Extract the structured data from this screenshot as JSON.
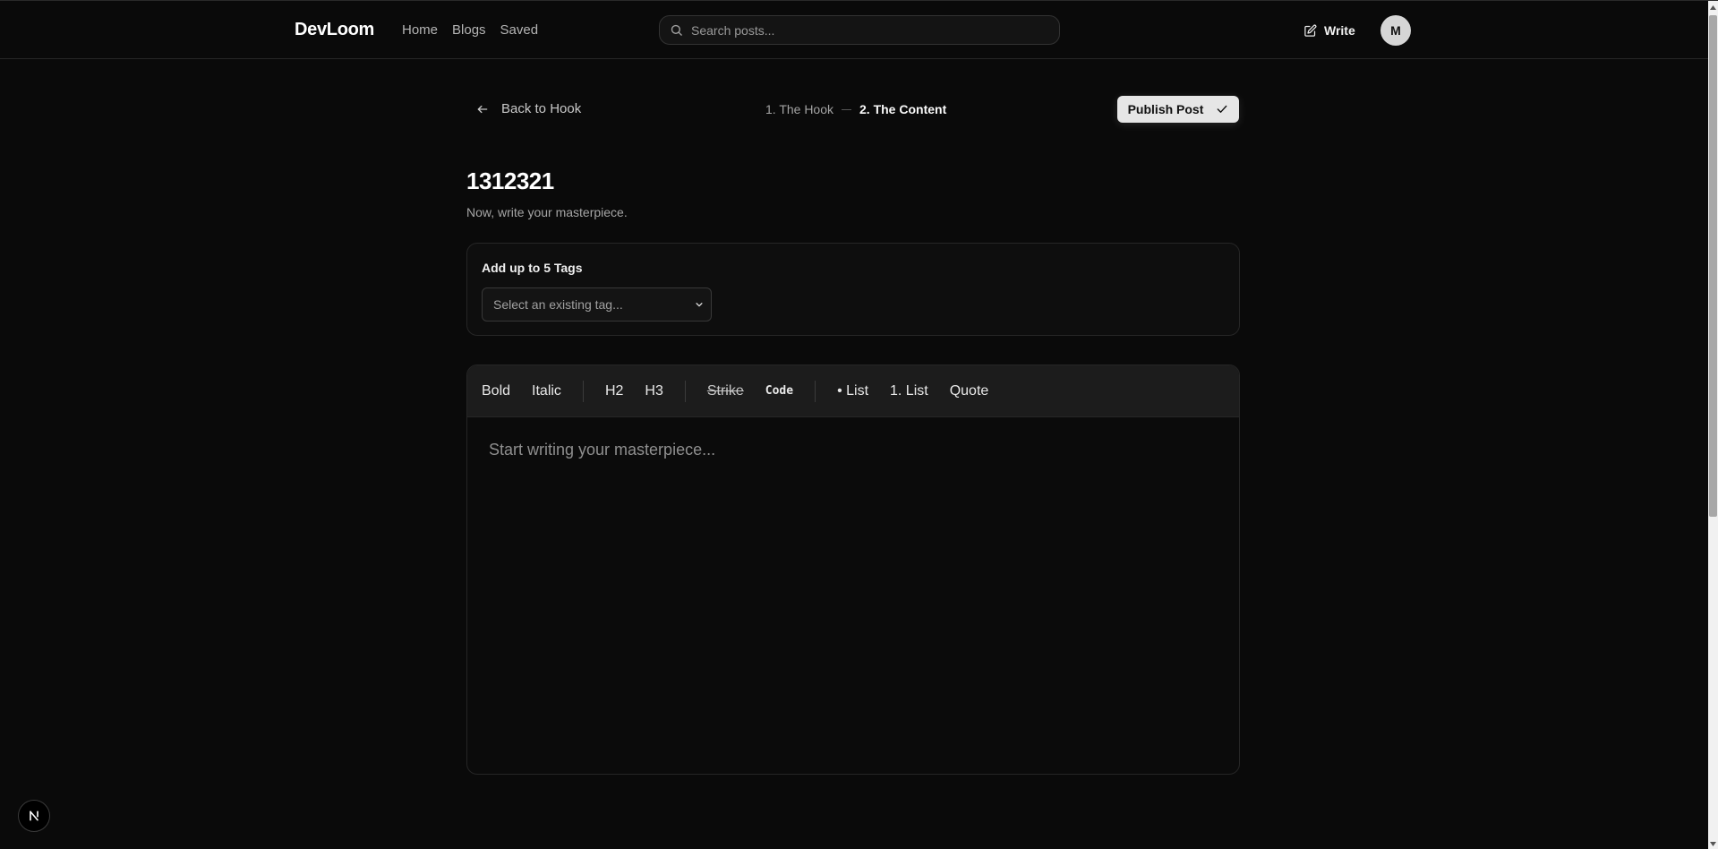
{
  "nav": {
    "brand": "DevLoom",
    "links": [
      "Home",
      "Blogs",
      "Saved"
    ],
    "search_placeholder": "Search posts...",
    "write_label": "Write",
    "avatar_initial": "M"
  },
  "editor_header": {
    "back_label": "Back to Hook",
    "step1_label": "1. The Hook",
    "step2_label": "2. The Content",
    "publish_label": "Publish Post"
  },
  "post": {
    "title": "1312321",
    "subtitle": "Now, write your masterpiece."
  },
  "tags": {
    "label": "Add up to 5 Tags",
    "select_placeholder": "Select an existing tag..."
  },
  "toolbar": {
    "bold": "Bold",
    "italic": "Italic",
    "h2": "H2",
    "h3": "H3",
    "strike": "Strike",
    "code": "Code",
    "bullet_list": "• List",
    "ordered_list": "1. List",
    "quote": "Quote"
  },
  "editor": {
    "placeholder": "Start writing your masterpiece..."
  },
  "colors": {
    "background": "#0a0a0a",
    "toolbar_bg": "#1c1c1c",
    "publish_bg": "#e6e6e6",
    "avatar_bg": "#d6d6d6"
  }
}
